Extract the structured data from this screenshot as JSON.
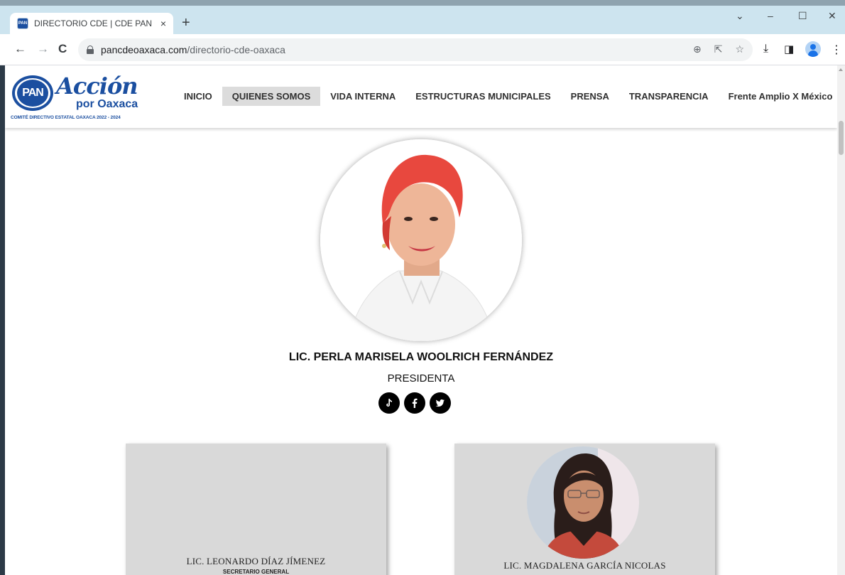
{
  "browser": {
    "tab_title": "DIRECTORIO CDE | CDE PAN OA",
    "tab_close": "×",
    "new_tab": "+",
    "url_host": "pancdeoaxaca.com",
    "url_path": "/directorio-cde-oaxaca",
    "icons": [
      "back-arrow-icon",
      "forward-arrow-icon",
      "reload-icon",
      "lock-icon",
      "zoom-icon",
      "share-icon",
      "star-icon",
      "download-icon",
      "side-panel-icon",
      "profile-icon",
      "menu-dots-icon"
    ]
  },
  "site": {
    "logo": {
      "pan": "PAN",
      "accion": "Acción",
      "por_oaxaca": "por Oaxaca",
      "comite": "COMITÉ DIRECTIVO ESTATAL OAXACA 2022 - 2024"
    },
    "nav": [
      {
        "label": "INICIO",
        "active": false
      },
      {
        "label": "QUIENES SOMOS",
        "active": true
      },
      {
        "label": "VIDA INTERNA",
        "active": false
      },
      {
        "label": "ESTRUCTURAS MUNICIPALES",
        "active": false
      },
      {
        "label": "PRENSA",
        "active": false
      },
      {
        "label": "TRANSPARENCIA",
        "active": false
      },
      {
        "label": "Frente Amplio X México",
        "active": false
      }
    ]
  },
  "president": {
    "name": "LIC. PERLA MARISELA WOOLRICH FERNÁNDEZ",
    "role": "PRESIDENTA",
    "social": [
      "tiktok-icon",
      "facebook-icon",
      "twitter-icon"
    ]
  },
  "cards": [
    {
      "name": "LIC. LEONARDO DÍAZ JÍMENEZ",
      "role": "SECRETARIO GENERAL"
    },
    {
      "name": "LIC. MAGDALENA  GARCÍA NICOLAS",
      "role": ""
    }
  ],
  "colors": {
    "brand_blue": "#1b4fa0",
    "titlebar": "#cde4ef",
    "nav_active_bg": "#dcdcdc",
    "card_bg": "#d9d9d9"
  }
}
